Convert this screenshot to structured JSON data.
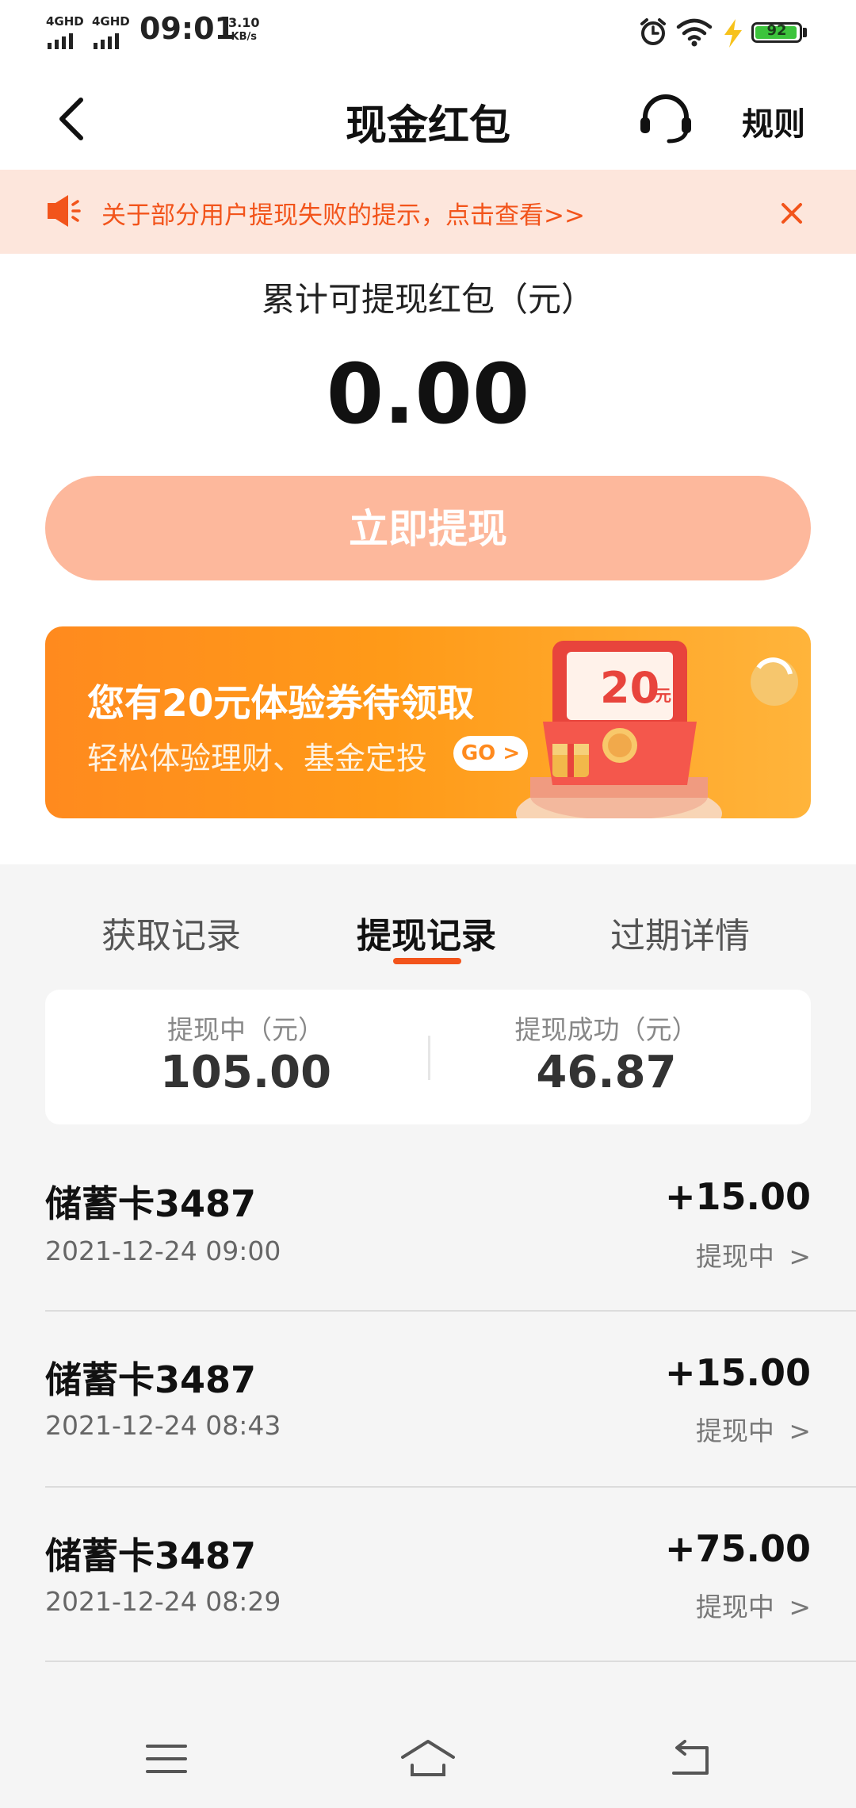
{
  "status_bar": {
    "signal1_label": "4GHD",
    "signal2_label": "4GHD",
    "time": "09:01",
    "net_speed_value": "3.10",
    "net_speed_unit": "KB/s",
    "battery_level": "92"
  },
  "header": {
    "title": "现金红包",
    "rules_label": "规则"
  },
  "notice": {
    "text": "关于部分用户提现失败的提示，点击查看>>"
  },
  "balance": {
    "label": "累计可提现红包（元）",
    "amount": "0.00",
    "withdraw_button": "立即提现"
  },
  "banner": {
    "title": "您有20元体验券待领取",
    "subtitle": "轻松体验理财、基金定投",
    "go_label": "GO",
    "coupon_amount": "20",
    "coupon_unit": "元"
  },
  "tabs": [
    {
      "label": "获取记录",
      "active": false
    },
    {
      "label": "提现记录",
      "active": true
    },
    {
      "label": "过期详情",
      "active": false
    }
  ],
  "summary": {
    "pending_label": "提现中（元）",
    "pending_value": "105.00",
    "success_label": "提现成功（元）",
    "success_value": "46.87"
  },
  "records": [
    {
      "name": "储蓄卡3487",
      "date": "2021-12-24 09:00",
      "amount": "+15.00",
      "status": "提现中"
    },
    {
      "name": "储蓄卡3487",
      "date": "2021-12-24 08:43",
      "amount": "+15.00",
      "status": "提现中"
    },
    {
      "name": "储蓄卡3487",
      "date": "2021-12-24 08:29",
      "amount": "+75.00",
      "status": "提现中"
    }
  ],
  "colors": {
    "accent": "#f2541b",
    "notice_bg": "#fde6dc",
    "button_bg": "#fdb89c",
    "banner_orange": "#ff8a1e"
  }
}
